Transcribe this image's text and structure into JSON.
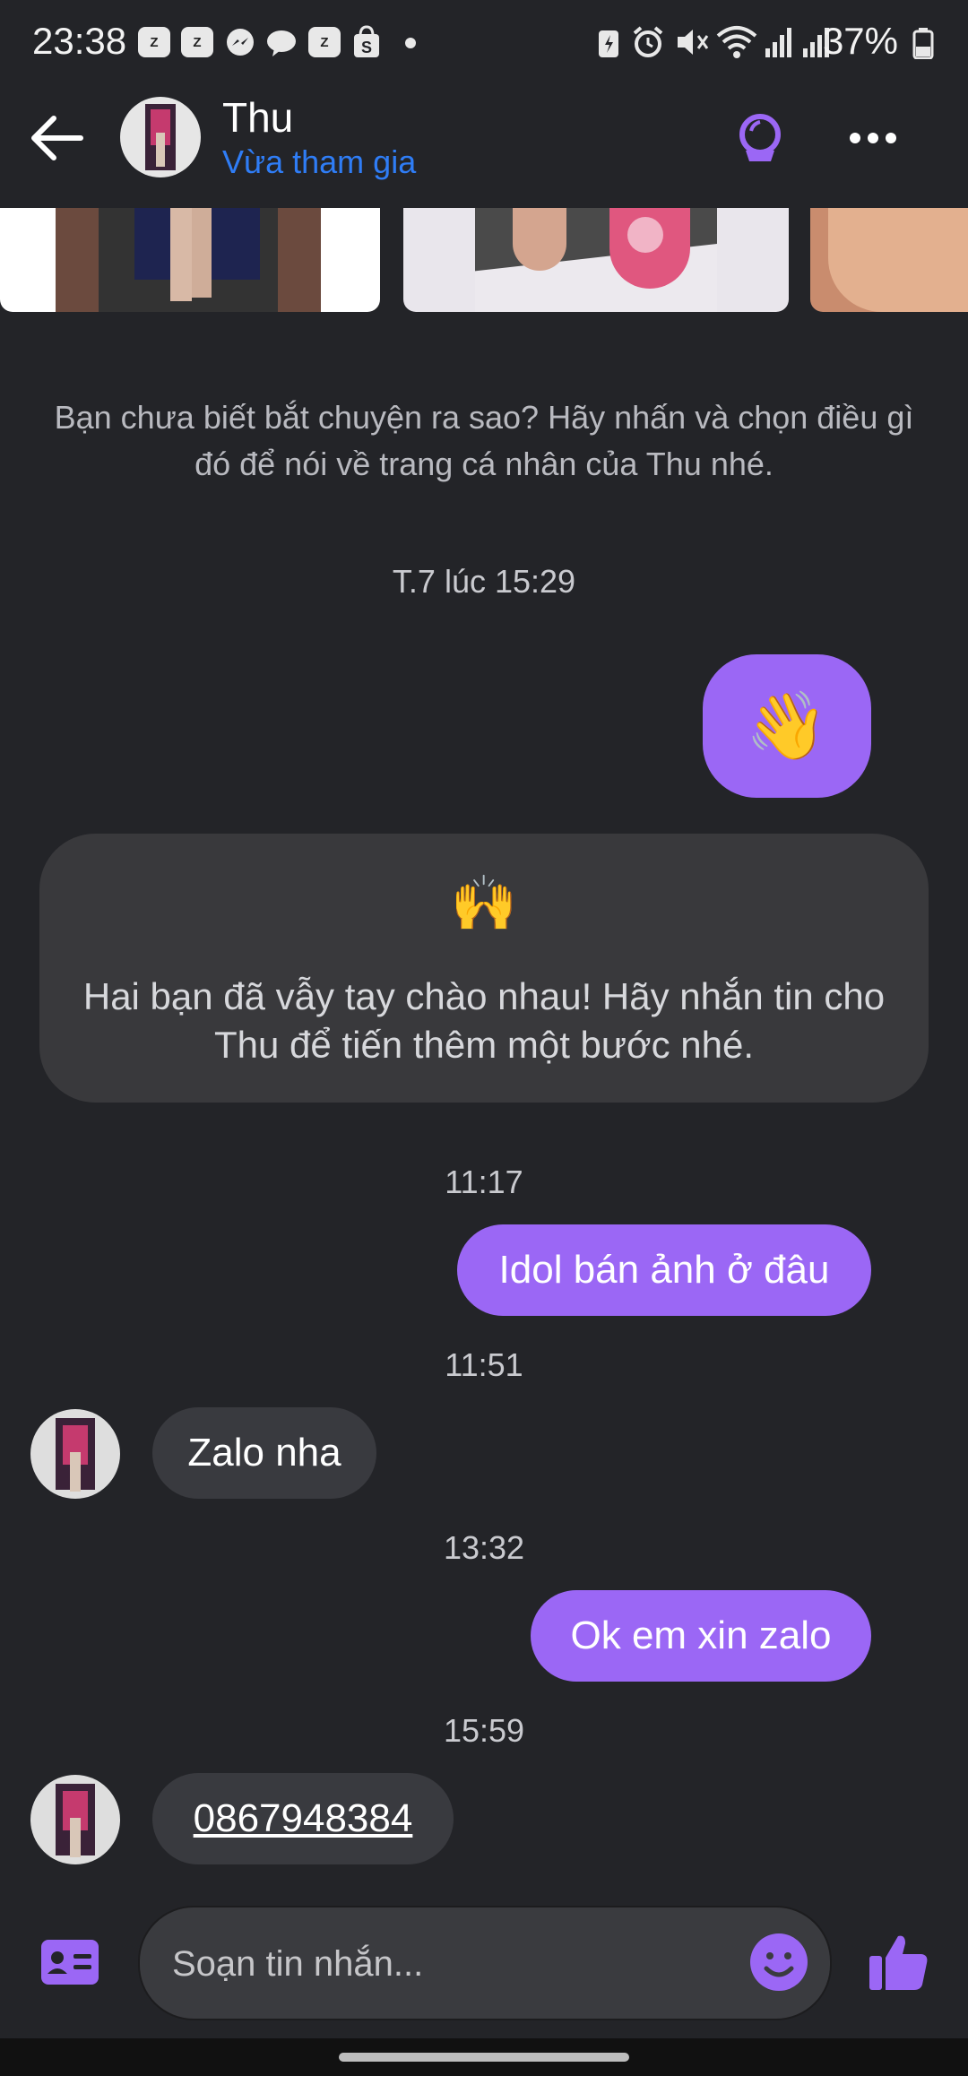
{
  "status_bar": {
    "time": "23:38",
    "battery": "37%",
    "notification_icons": [
      "zalo-icon",
      "zalo-icon",
      "messenger-icon",
      "chat-icon",
      "zalo-icon",
      "shopee-icon"
    ]
  },
  "header": {
    "name": "Thu",
    "status": "Vừa tham gia"
  },
  "hint": "Bạn chưa biết bắt chuyện ra sao? Hãy nhấn và chọn điều gì đó để nói về trang cá nhân của Thu nhé.",
  "messages": {
    "ts1": "T.7 lúc 15:29",
    "wave_emoji": "👋",
    "wave_card_emoji": "🙌",
    "wave_card_text": "Hai bạn đã vẫy tay chào nhau! Hãy nhắn tin cho Thu để tiến thêm một bước nhé.",
    "ts2": "11:17",
    "out1": "Idol bán ảnh ở đâu",
    "ts3": "11:51",
    "in1": "Zalo nha",
    "ts4": "13:32",
    "out2": "Ok em xin zalo",
    "ts5": "15:59",
    "in2": "0867948384"
  },
  "composer": {
    "placeholder": "Soạn tin nhắn..."
  },
  "colors": {
    "accent": "#9b67f5",
    "link_blue": "#2f7df6",
    "background": "#232428"
  }
}
